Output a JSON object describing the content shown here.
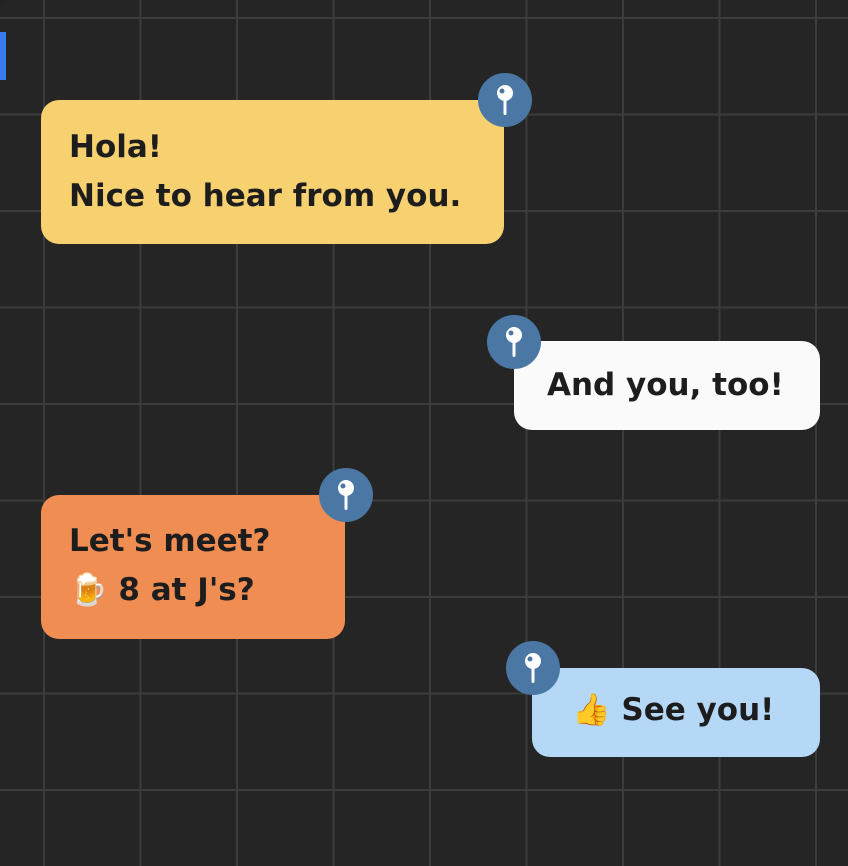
{
  "canvas": {
    "background": "#252525",
    "grid_color": "#3c3c3c"
  },
  "notes": [
    {
      "lines": [
        "Hola!",
        "Nice to hear from you."
      ],
      "color": "#f7d170",
      "pin_icon": "pin-icon"
    },
    {
      "lines": [
        "And you, too!"
      ],
      "color": "#fafafa",
      "pin_icon": "pin-icon"
    },
    {
      "lines": [
        "Let's meet?",
        "🍺 8 at J's?"
      ],
      "color": "#ef8d53",
      "pin_icon": "pin-icon"
    },
    {
      "lines": [
        "👍 See you!"
      ],
      "color": "#b6d8f7",
      "pin_icon": "pin-icon"
    }
  ],
  "pin_color": "#4a77a4"
}
